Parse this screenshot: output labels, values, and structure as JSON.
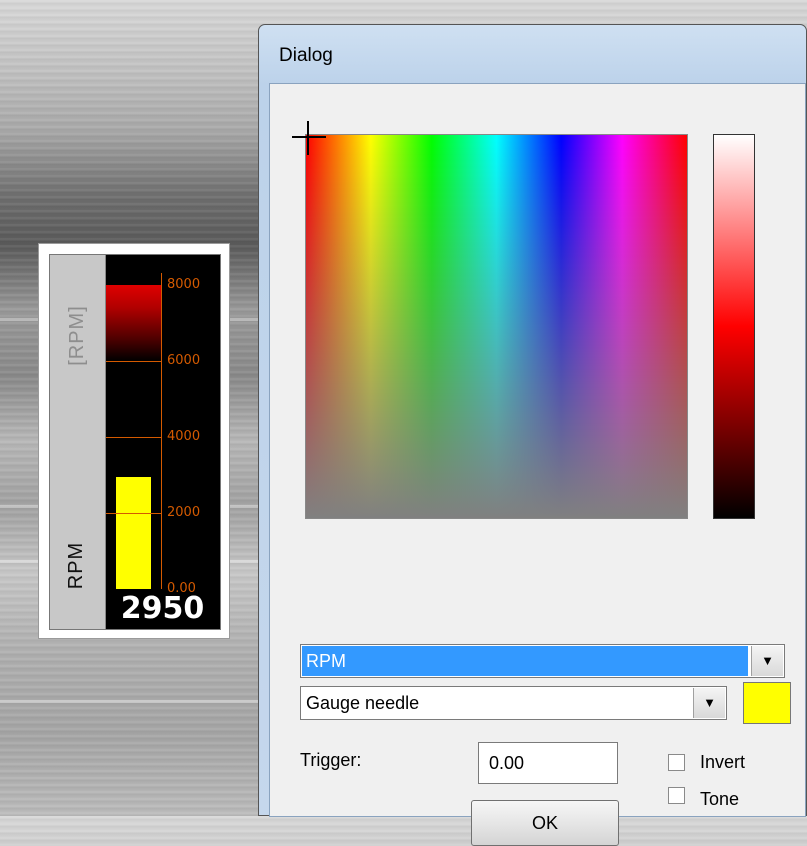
{
  "gauge": {
    "unit_label": "[RPM]",
    "name_label": "RPM",
    "readout": "2950",
    "value": 2950,
    "max": 8000,
    "redline_start": 6000,
    "ticks": [
      "8000",
      "6000",
      "4000",
      "2000",
      "0.00"
    ],
    "bar_color": "#ffff00",
    "redline_color": "#e00000",
    "scale_color": "#d45a00"
  },
  "dialog": {
    "title": "Dialog",
    "channel_select": {
      "value": "RPM"
    },
    "style_select": {
      "value": "Gauge needle"
    },
    "color_swatch": "#ffff00",
    "trigger_label": "Trigger:",
    "trigger_value": "0.00",
    "invert_label": "Invert",
    "tone_label": "Tone",
    "ok_label": "OK",
    "selection_color": "#3399ff"
  }
}
